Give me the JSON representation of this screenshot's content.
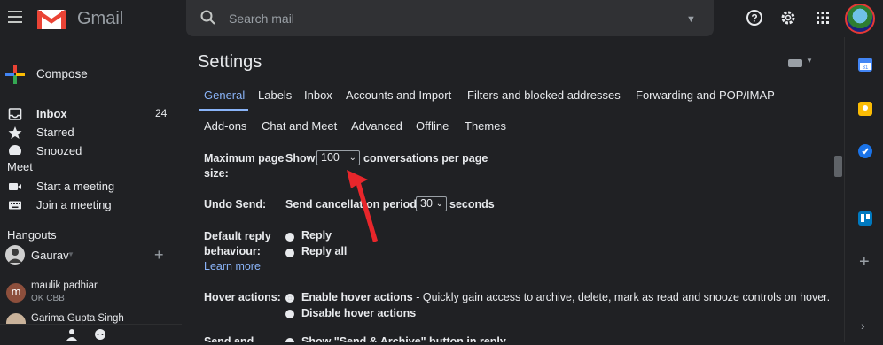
{
  "header": {
    "app_name": "Gmail",
    "search_placeholder": "Search mail"
  },
  "sidebar": {
    "compose_label": "Compose",
    "items": [
      {
        "label": "Inbox",
        "count": "24",
        "icon": "inbox-icon"
      },
      {
        "label": "Starred",
        "icon": "star-icon"
      },
      {
        "label": "Snoozed",
        "icon": "clock-icon"
      }
    ],
    "meet": {
      "title": "Meet",
      "items": [
        {
          "label": "Start a meeting",
          "icon": "video-camera-icon"
        },
        {
          "label": "Join a meeting",
          "icon": "keyboard-icon"
        }
      ]
    },
    "hangouts": {
      "title": "Hangouts",
      "user": "Gaurav",
      "contacts": [
        {
          "initial": "m",
          "name": "maulik padhiar",
          "status": "OK CBB"
        },
        {
          "name": "Garima Gupta Singh"
        }
      ]
    }
  },
  "settings": {
    "title": "Settings",
    "tabs_row1": [
      "General",
      "Labels",
      "Inbox",
      "Accounts and Import",
      "Filters and blocked addresses",
      "Forwarding and POP/IMAP"
    ],
    "tabs_row2": [
      "Add-ons",
      "Chat and Meet",
      "Advanced",
      "Offline",
      "Themes"
    ],
    "active_tab": "General",
    "max_page": {
      "label_line1": "Maximum page",
      "label_line2": "size:",
      "prefix": "Show",
      "value": "100",
      "suffix": "conversations per page"
    },
    "undo_send": {
      "label": "Undo Send:",
      "prefix": "Send cancellation period:",
      "value": "30",
      "suffix": "seconds"
    },
    "default_reply": {
      "label_line1": "Default reply",
      "label_line2": "behaviour:",
      "learn_more": "Learn more",
      "options": [
        "Reply",
        "Reply all"
      ]
    },
    "hover_actions": {
      "label": "Hover actions:",
      "enable": "Enable hover actions",
      "enable_desc": " - Quickly gain access to archive, delete, mark as read and snooze controls on hover.",
      "disable": "Disable hover actions"
    },
    "send_archive": {
      "label": "Send and",
      "option": "Show \"Send & Archive\" button in reply"
    }
  },
  "colors": {
    "accent": "#8ab4f8",
    "background": "#202124",
    "arrow": "#e8262b"
  }
}
